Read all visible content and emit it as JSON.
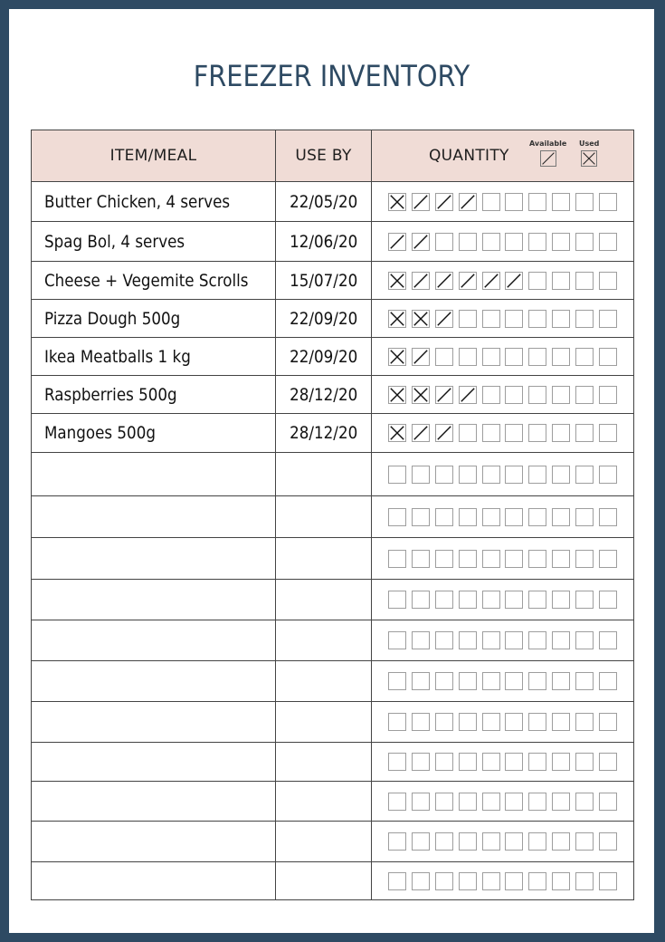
{
  "title": "FREEZER INVENTORY",
  "colors": {
    "border_frame": "#2e4a63",
    "title": "#2e4a63",
    "header_bg": "#f0dcd6",
    "grid_line": "#444444",
    "box_line": "#9e9e9e"
  },
  "header": {
    "item_label": "ITEM/MEAL",
    "use_by_label": "USE BY",
    "quantity_label": "QUANTITY",
    "legend": {
      "available_label": "Available",
      "available_icon": "slash-box-icon",
      "used_label": "Used",
      "used_icon": "cross-box-icon"
    }
  },
  "boxes_per_row": 10,
  "rows": [
    {
      "item": "Butter Chicken, 4 serves",
      "use_by": "22/05/20",
      "boxes": [
        "x",
        "/",
        "/",
        "/",
        "",
        "",
        "",
        "",
        "",
        ""
      ]
    },
    {
      "item": "Spag Bol, 4 serves",
      "use_by": "12/06/20",
      "boxes": [
        "/",
        "/",
        "",
        "",
        "",
        "",
        "",
        "",
        "",
        ""
      ]
    },
    {
      "item": "Cheese + Vegemite Scrolls",
      "use_by": "15/07/20",
      "boxes": [
        "x",
        "/",
        "/",
        "/",
        "/",
        "/",
        "",
        "",
        "",
        ""
      ]
    },
    {
      "item": "Pizza Dough 500g",
      "use_by": "22/09/20",
      "boxes": [
        "x",
        "x",
        "/",
        "",
        "",
        "",
        "",
        "",
        "",
        ""
      ]
    },
    {
      "item": "Ikea Meatballs 1 kg",
      "use_by": "22/09/20",
      "boxes": [
        "x",
        "/",
        "",
        "",
        "",
        "",
        "",
        "",
        "",
        ""
      ]
    },
    {
      "item": "Raspberries 500g",
      "use_by": "28/12/20",
      "boxes": [
        "x",
        "x",
        "/",
        "/",
        "",
        "",
        "",
        "",
        "",
        ""
      ]
    },
    {
      "item": "Mangoes 500g",
      "use_by": "28/12/20",
      "boxes": [
        "x",
        "/",
        "/",
        "",
        "",
        "",
        "",
        "",
        "",
        ""
      ]
    },
    {
      "item": "",
      "use_by": "",
      "boxes": [
        "",
        "",
        "",
        "",
        "",
        "",
        "",
        "",
        "",
        ""
      ]
    },
    {
      "item": "",
      "use_by": "",
      "boxes": [
        "",
        "",
        "",
        "",
        "",
        "",
        "",
        "",
        "",
        ""
      ]
    },
    {
      "item": "",
      "use_by": "",
      "boxes": [
        "",
        "",
        "",
        "",
        "",
        "",
        "",
        "",
        "",
        ""
      ]
    },
    {
      "item": "",
      "use_by": "",
      "boxes": [
        "",
        "",
        "",
        "",
        "",
        "",
        "",
        "",
        "",
        ""
      ]
    },
    {
      "item": "",
      "use_by": "",
      "boxes": [
        "",
        "",
        "",
        "",
        "",
        "",
        "",
        "",
        "",
        ""
      ]
    },
    {
      "item": "",
      "use_by": "",
      "boxes": [
        "",
        "",
        "",
        "",
        "",
        "",
        "",
        "",
        "",
        ""
      ]
    },
    {
      "item": "",
      "use_by": "",
      "boxes": [
        "",
        "",
        "",
        "",
        "",
        "",
        "",
        "",
        "",
        ""
      ]
    },
    {
      "item": "",
      "use_by": "",
      "boxes": [
        "",
        "",
        "",
        "",
        "",
        "",
        "",
        "",
        "",
        ""
      ]
    },
    {
      "item": "",
      "use_by": "",
      "boxes": [
        "",
        "",
        "",
        "",
        "",
        "",
        "",
        "",
        "",
        ""
      ]
    },
    {
      "item": "",
      "use_by": "",
      "boxes": [
        "",
        "",
        "",
        "",
        "",
        "",
        "",
        "",
        "",
        ""
      ]
    },
    {
      "item": "",
      "use_by": "",
      "boxes": [
        "",
        "",
        "",
        "",
        "",
        "",
        "",
        "",
        "",
        ""
      ]
    }
  ]
}
